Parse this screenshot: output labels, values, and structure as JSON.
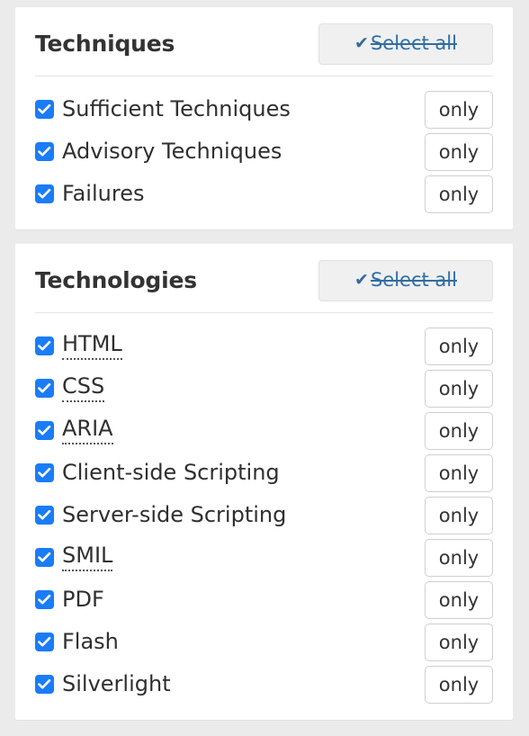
{
  "background_color": "#ebebeb",
  "accent_checkbox_color": "#1a7cf7",
  "link_color": "#2f6ea5",
  "panels": [
    {
      "title": "Techniques",
      "select_all": {
        "label": "Select all",
        "icon": "check-icon",
        "struck_through": true
      },
      "only_label": "only",
      "items": [
        {
          "label": "Sufficient Techniques",
          "checked": true,
          "abbr": false,
          "only_label": "only"
        },
        {
          "label": "Advisory Techniques",
          "checked": true,
          "abbr": false,
          "only_label": "only"
        },
        {
          "label": "Failures",
          "checked": true,
          "abbr": false,
          "only_label": "only"
        }
      ]
    },
    {
      "title": "Technologies",
      "select_all": {
        "label": "Select all",
        "icon": "check-icon",
        "struck_through": true
      },
      "only_label": "only",
      "items": [
        {
          "label": "HTML",
          "checked": true,
          "abbr": true,
          "only_label": "only"
        },
        {
          "label": "CSS",
          "checked": true,
          "abbr": true,
          "only_label": "only"
        },
        {
          "label": "ARIA",
          "checked": true,
          "abbr": true,
          "only_label": "only"
        },
        {
          "label": "Client-side Scripting",
          "checked": true,
          "abbr": false,
          "only_label": "only"
        },
        {
          "label": "Server-side Scripting",
          "checked": true,
          "abbr": false,
          "only_label": "only"
        },
        {
          "label": "SMIL",
          "checked": true,
          "abbr": true,
          "only_label": "only"
        },
        {
          "label": "PDF",
          "checked": true,
          "abbr": false,
          "only_label": "only"
        },
        {
          "label": "Flash",
          "checked": true,
          "abbr": false,
          "only_label": "only"
        },
        {
          "label": "Silverlight",
          "checked": true,
          "abbr": false,
          "only_label": "only"
        }
      ]
    }
  ]
}
